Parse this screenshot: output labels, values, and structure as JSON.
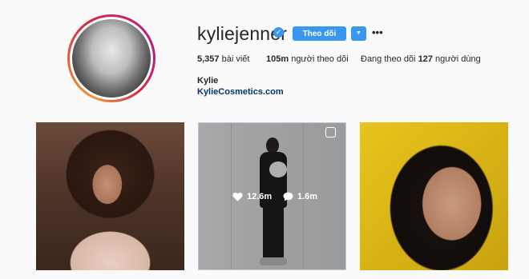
{
  "profile": {
    "username": "kyliejenner",
    "verified_icon": "verified-check-icon",
    "follow_label": "Theo dõi",
    "dropdown_icon": "▼",
    "more_icon": "•••",
    "posts_count": "5,357",
    "posts_label": " bài viết",
    "followers_count": "105m",
    "followers_label": " người theo dõi",
    "following_prefix": "Đang theo dõi ",
    "following_count": "127",
    "following_label": " người dùng",
    "full_name": "Kylie",
    "website": "KylieCosmetics.com"
  },
  "posts": [
    {
      "icon": "photo"
    },
    {
      "likes": "12.6m",
      "comments": "1.6m",
      "hover": true
    },
    {
      "icon": "photo"
    }
  ],
  "colors": {
    "accent": "#3897f0",
    "link": "#003569",
    "text": "#262626",
    "background": "#fafafa"
  }
}
